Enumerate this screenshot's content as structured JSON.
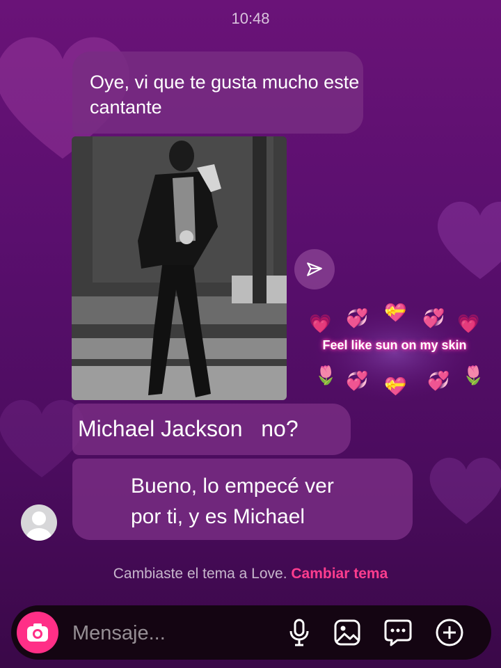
{
  "status": {
    "time": "10:48"
  },
  "messages": [
    {
      "text": "Oye, vi que te gusta mucho este cantante"
    },
    {
      "text": "Michael Jackson   no?"
    },
    {
      "text": "Bueno, lo empecé ver\npor ti, y es  Michael"
    }
  ],
  "sticker": {
    "text": "Feel like sun on my skin"
  },
  "notice": {
    "text": "Cambiaste el tema a Love.",
    "link": "Cambiar tema"
  },
  "composer": {
    "placeholder": "Mensaje..."
  },
  "colors": {
    "accent": "#ff2f87",
    "link": "#ff3d8e",
    "bubble": "#782d82"
  },
  "icons": [
    "share-icon",
    "camera-icon",
    "microphone-icon",
    "gallery-icon",
    "sticker-icon",
    "plus-icon"
  ]
}
